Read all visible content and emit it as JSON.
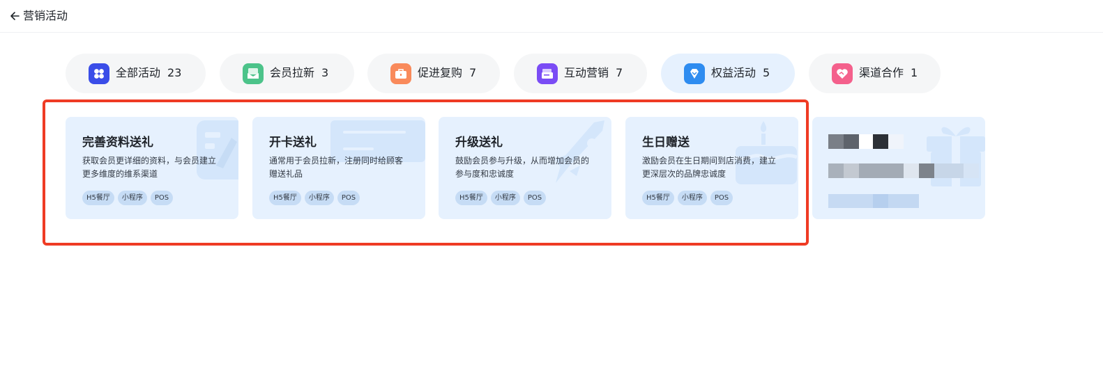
{
  "header": {
    "title": "营销活动",
    "back_icon": "arrow-left-icon"
  },
  "tabs": [
    {
      "label": "全部活动",
      "count": "23",
      "icon": "grid-icon",
      "color": "#3a4de8",
      "active": false
    },
    {
      "label": "会员拉新",
      "count": "3",
      "icon": "envelope-icon",
      "color": "#4cc38a",
      "active": false
    },
    {
      "label": "促进复购",
      "count": "7",
      "icon": "briefcase-icon",
      "color": "#f98a5b",
      "active": false
    },
    {
      "label": "互动营销",
      "count": "7",
      "icon": "ticket-icon",
      "color": "#7a4cf5",
      "active": false
    },
    {
      "label": "权益活动",
      "count": "5",
      "icon": "diamond-icon",
      "color": "#2e8cf0",
      "active": true
    },
    {
      "label": "渠道合作",
      "count": "1",
      "icon": "handshake-heart-icon",
      "color": "#f4608c",
      "active": false
    }
  ],
  "cards": [
    {
      "title": "完善资料送礼",
      "desc": "获取会员更详细的资料，与会员建立更多维度的维系渠道",
      "tags": [
        "H5餐厅",
        "小程序",
        "POS"
      ],
      "deco_icon": "form-edit-icon"
    },
    {
      "title": "开卡送礼",
      "desc": "通常用于会员拉新，注册同时给顾客赠送礼品",
      "tags": [
        "H5餐厅",
        "小程序",
        "POS"
      ],
      "deco_icon": "card-icon"
    },
    {
      "title": "升级送礼",
      "desc": "鼓励会员参与升级，从而增加会员的参与度和忠诚度",
      "tags": [
        "H5餐厅",
        "小程序",
        "POS"
      ],
      "deco_icon": "rocket-icon"
    },
    {
      "title": "生日赠送",
      "desc": "激励会员在生日期间到店消费，建立更深层次的品牌忠诚度",
      "tags": [
        "H5餐厅",
        "小程序",
        "POS"
      ],
      "deco_icon": "birthday-cake-icon"
    }
  ],
  "blurred_card": {
    "deco_icon": "gift-icon"
  },
  "colors": {
    "tab_bg": "#f5f6f7",
    "tab_active_bg": "#e6f1fe",
    "card_bg": "#e6f1fe",
    "tag_bg": "#c6dcf5",
    "highlight_border": "#ef3b24"
  }
}
